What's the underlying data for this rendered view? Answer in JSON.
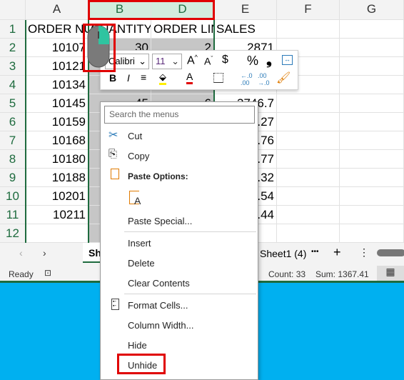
{
  "columns": [
    "A",
    "B",
    "D",
    "E",
    "F",
    "G"
  ],
  "rows": [
    "1",
    "2",
    "3",
    "4",
    "5",
    "6",
    "7",
    "8",
    "9",
    "10",
    "11",
    "12"
  ],
  "cells": {
    "A": [
      "ORDER NUMBER",
      "10107",
      "10121",
      "10134",
      "10145",
      "10159",
      "10168",
      "10180",
      "10188",
      "10201",
      "10211",
      ""
    ],
    "B": [
      "QUANTITY",
      "30",
      "",
      "",
      "45",
      "",
      "",
      "",
      "",
      "",
      "",
      ""
    ],
    "D": [
      "ORDER LIN",
      "2",
      "",
      "",
      "6",
      "",
      "",
      "",
      "",
      "",
      "",
      ""
    ],
    "E": [
      "SALES",
      "2871",
      "",
      "",
      "3746.7",
      ".27",
      ".76",
      ".77",
      ".32",
      ".54",
      ".44",
      ""
    ]
  },
  "mini_toolbar": {
    "font": "Calibri",
    "size": "11",
    "bold": "B",
    "italic": "I",
    "dollar": "$",
    "percent": "%",
    "comma": "❟"
  },
  "menu": {
    "search_placeholder": "Search the menus",
    "cut": "Cut",
    "copy": "Copy",
    "paste_options": "Paste Options:",
    "paste_special": "Paste Special...",
    "insert": "Insert",
    "delete": "Delete",
    "clear_contents": "Clear Contents",
    "format_cells": "Format Cells...",
    "column_width": "Column Width...",
    "hide": "Hide",
    "unhide": "Unhide"
  },
  "tabs": {
    "active": "Sh",
    "other": "Sheet1 (4)",
    "more": "•••",
    "add": "+"
  },
  "status": {
    "ready": "Ready",
    "count": "Count: 33",
    "sum": "Sum: 1367.41"
  },
  "colors": {
    "accent": "#1e6b3e",
    "highlight": "#e00000",
    "desktop": "#00b0f0"
  }
}
